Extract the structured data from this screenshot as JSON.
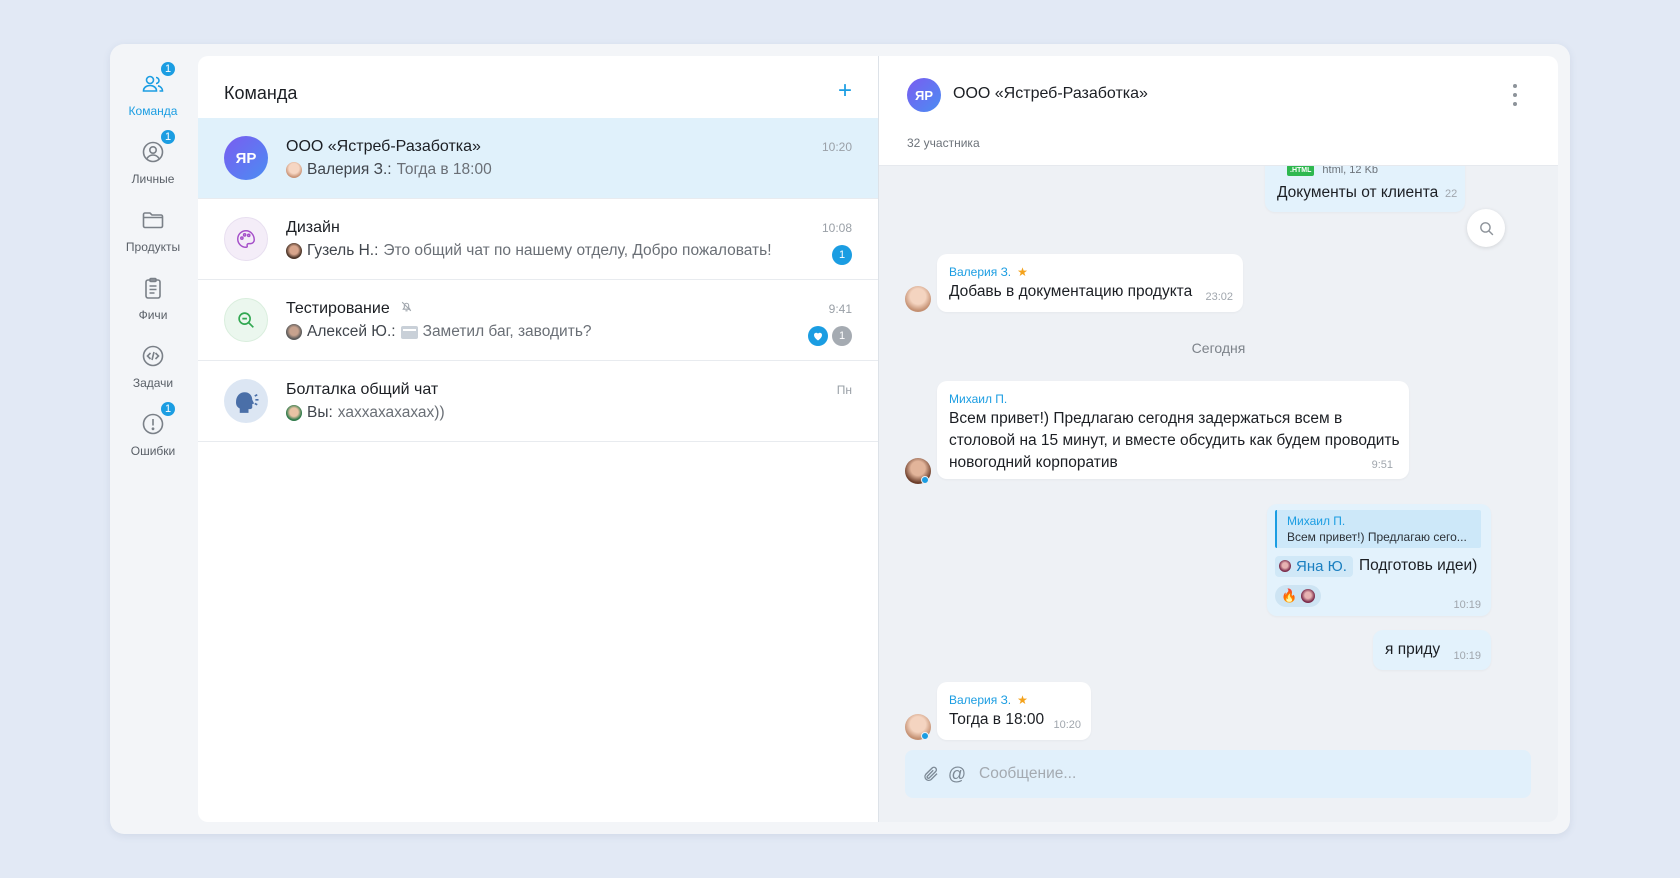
{
  "colors": {
    "accent": "#1b9de2",
    "star": "#f4a21c"
  },
  "rail": {
    "items": [
      {
        "label": "Команда",
        "icon": "team-icon",
        "badge": "1",
        "active": true
      },
      {
        "label": "Личные",
        "icon": "personal-icon",
        "badge": "1"
      },
      {
        "label": "Продукты",
        "icon": "folder-icon"
      },
      {
        "label": "Фичи",
        "icon": "clipboard-icon"
      },
      {
        "label": "Задачи",
        "icon": "code-icon"
      },
      {
        "label": "Ошибки",
        "icon": "error-icon",
        "badge": "1"
      }
    ]
  },
  "list": {
    "title": "Команда",
    "add_label": "+",
    "chats": [
      {
        "avatar_text": "ЯР",
        "name": "ООО «Ястреб-Разаботка»",
        "sender": "Валерия З.:",
        "preview": "Тогда в 18:00",
        "time": "10:20"
      },
      {
        "name": "Дизайн",
        "sender": "Гузель Н.:",
        "preview": "Это общий чат по нашему отделу, Добро пожаловать!",
        "time": "10:08",
        "unread": "1"
      },
      {
        "name": "Тестирование",
        "sender": "Алексей Ю.:",
        "preview": "Заметил баг, заводить?",
        "time": "9:41",
        "unread": "1",
        "muted": true
      },
      {
        "name": "Болталка общий чат",
        "sender": "Вы:",
        "preview": "хаххахахахах))",
        "time": "Пн"
      }
    ]
  },
  "conversation": {
    "avatar_text": "ЯР",
    "title": "ООО «Ястреб-Разаботка»",
    "members": "32 участника",
    "file_meta": "html, 12 Kb",
    "file_badge": ".HTML",
    "file_caption": "Документы от клиента",
    "file_time": "22",
    "m1": {
      "author": "Валерия З.",
      "text": "Добавь в документацию продукта",
      "time": "23:02"
    },
    "date_sep": "Сегодня",
    "m2": {
      "author": "Михаил П.",
      "lines": [
        "Всем привет!) Предлагаю сегодня задержаться всем в",
        "столовой на 15 минут, и вместе обсудить как будем проводить",
        "новогодний корпоратив"
      ],
      "time": "9:51"
    },
    "m3": {
      "quote_author": "Михаил П.",
      "quote_text": "Всем привет!) Предлагаю сего...",
      "mention": "Яна Ю.",
      "text": "Подготовь идеи)",
      "reaction": "🔥",
      "time": "10:19"
    },
    "m4": {
      "text": "я приду",
      "time": "10:19"
    },
    "m5": {
      "author": "Валерия З.",
      "text": "Тогда в 18:00",
      "time": "10:20"
    },
    "composer_placeholder": "Сообщение..."
  }
}
